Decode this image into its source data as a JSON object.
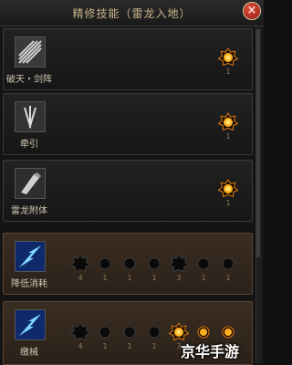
{
  "window": {
    "title": "精修技能（雷龙入地）",
    "close_label": "×"
  },
  "skills": [
    {
      "name": "破天・剑阵",
      "icon": "blade-array-icon",
      "slots": [
        {
          "state": "lit-star",
          "count": "1"
        }
      ]
    },
    {
      "name": "牵引",
      "icon": "pull-icon",
      "slots": [
        {
          "state": "lit-star",
          "count": "1"
        }
      ]
    },
    {
      "name": "雷龙附体",
      "icon": "thunder-dragon-icon",
      "slots": [
        {
          "state": "lit-star",
          "count": "1"
        }
      ]
    },
    {
      "name": "降低消耗",
      "icon": "lightning-blue-icon",
      "slots": [
        {
          "state": "dark-star",
          "count": "4"
        },
        {
          "state": "dark-dot",
          "count": "1"
        },
        {
          "state": "dark-dot",
          "count": "1"
        },
        {
          "state": "dark-dot",
          "count": "1"
        },
        {
          "state": "dark-star",
          "count": "3"
        },
        {
          "state": "dark-dot",
          "count": "1"
        },
        {
          "state": "dark-dot",
          "count": "1"
        }
      ]
    },
    {
      "name": "缴械",
      "icon": "lightning-blue-icon",
      "slots": [
        {
          "state": "dark-star",
          "count": "4"
        },
        {
          "state": "dark-dot",
          "count": "1"
        },
        {
          "state": "dark-dot",
          "count": "1"
        },
        {
          "state": "dark-dot",
          "count": "1"
        },
        {
          "state": "lit-star",
          "count": "3"
        },
        {
          "state": "lit-dot",
          "count": "1"
        },
        {
          "state": "lit-dot",
          "count": "1"
        }
      ]
    }
  ],
  "watermark": "京华手游",
  "colors": {
    "accent": "#c9b48a",
    "lit": "#f0a020",
    "dark": "#0c0c0c"
  }
}
